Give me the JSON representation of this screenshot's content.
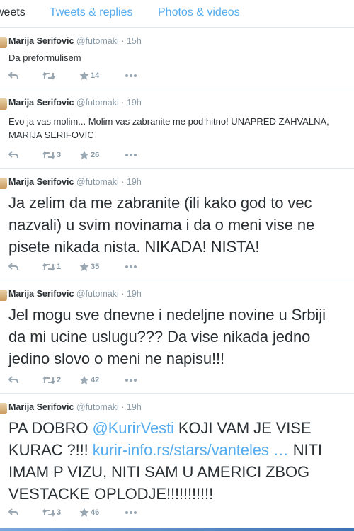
{
  "tabs": [
    "weets",
    "Tweets & replies",
    "Photos & videos"
  ],
  "tweets": [
    {
      "name": "Marija Serifovic",
      "handle": "@futomaki",
      "dot": "·",
      "time": "15h",
      "text": "Da preformulisem",
      "retweets": "",
      "favorites": "14"
    },
    {
      "name": "Marija Serifovic",
      "handle": "@futomaki",
      "dot": "·",
      "time": "19h",
      "text": "Evo ja vas molim... Molim vas zabranite me pod hitno! UNAPRED ZAHVALNA, MARIJA SERIFOVIC",
      "retweets": "3",
      "favorites": "26"
    },
    {
      "name": "Marija Serifovic",
      "handle": "@futomaki",
      "dot": "·",
      "time": "19h",
      "text": "Ja zelim da me zabranite (ili kako god to vec nazvali) u svim novinama i da o meni vise ne pisete nikada nista. NIKADA! NISTA!",
      "retweets": "1",
      "favorites": "35"
    },
    {
      "name": "Marija Serifovic",
      "handle": "@futomaki",
      "dot": "·",
      "time": "19h",
      "text": "Jel mogu sve dnevne i nedeljne novine u Srbiji da mi ucine uslugu??? Da vise nikada jedno jedino slovo o meni ne napisu!!!",
      "retweets": "2",
      "favorites": "42"
    },
    {
      "name": "Marija Serifovic",
      "handle": "@futomaki",
      "dot": "·",
      "time": "19h",
      "text_parts": [
        "PA DOBRO ",
        "@KurirVesti",
        " KOJI VAM JE VISE KURAC ?!!! ",
        "kurir-info.rs/stars/vanteles …",
        " NITI IMAM P VIZU, NITI SAM U AMERICI ZBOG VESTACKE OPLODJE!!!!!!!!!!!"
      ],
      "retweets": "3",
      "favorites": "46"
    }
  ],
  "icons": {
    "reply": "reply-arrow-icon",
    "retweet": "retweet-icon",
    "favorite": "star-icon",
    "more": "more-dots-icon"
  },
  "colors": {
    "accent": "#55acee",
    "text": "#292f33",
    "muted": "#8899a6"
  }
}
